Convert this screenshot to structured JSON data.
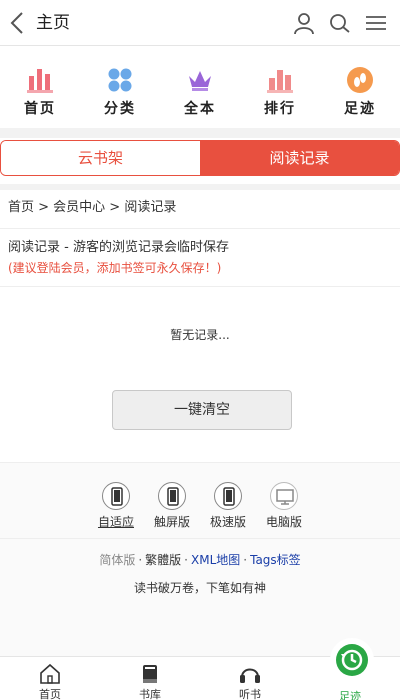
{
  "header": {
    "title": "主页"
  },
  "nav": {
    "items": [
      {
        "label": "首页",
        "icon": "bar-chart-icon"
      },
      {
        "label": "分类",
        "icon": "grid-icon"
      },
      {
        "label": "全本",
        "icon": "crown-icon"
      },
      {
        "label": "排行",
        "icon": "ranking-icon"
      },
      {
        "label": "足迹",
        "icon": "footprint-icon"
      }
    ]
  },
  "tabs": {
    "bookshelf": "云书架",
    "history": "阅读记录",
    "active": "阅读记录"
  },
  "breadcrumb": "首页 > 会员中心 > 阅读记录",
  "content": {
    "description": "阅读记录 - 游客的浏览记录会临时保存",
    "notice": "(建议登陆会员，添加书签可永久保存！)",
    "empty": "暂无记录...",
    "clear_button": "一键清空"
  },
  "footer": {
    "versions": [
      "自适应",
      "触屏版",
      "极速版",
      "电脑版"
    ],
    "lang": {
      "simplified": "简体版",
      "traditional": "繁體版",
      "xml_map": "XML地图",
      "tags": "Tags标签",
      "separator": "·"
    },
    "slogan": "读书破万卷，下笔如有神"
  },
  "bottom_nav": {
    "items": [
      {
        "label": "首页",
        "icon": "home-icon"
      },
      {
        "label": "书库",
        "icon": "book-icon"
      },
      {
        "label": "听书",
        "icon": "headphones-icon"
      },
      {
        "label": "足迹",
        "icon": "history-icon"
      }
    ],
    "active": "足迹"
  },
  "colors": {
    "accent": "#e8503f",
    "nav_pink": "#ee6e7a",
    "nav_blue": "#6aa8e8",
    "nav_purple": "#9a66d8",
    "nav_orange": "#f59a4e",
    "active_green": "#2aa745",
    "link_blue": "#1a3ea8"
  }
}
